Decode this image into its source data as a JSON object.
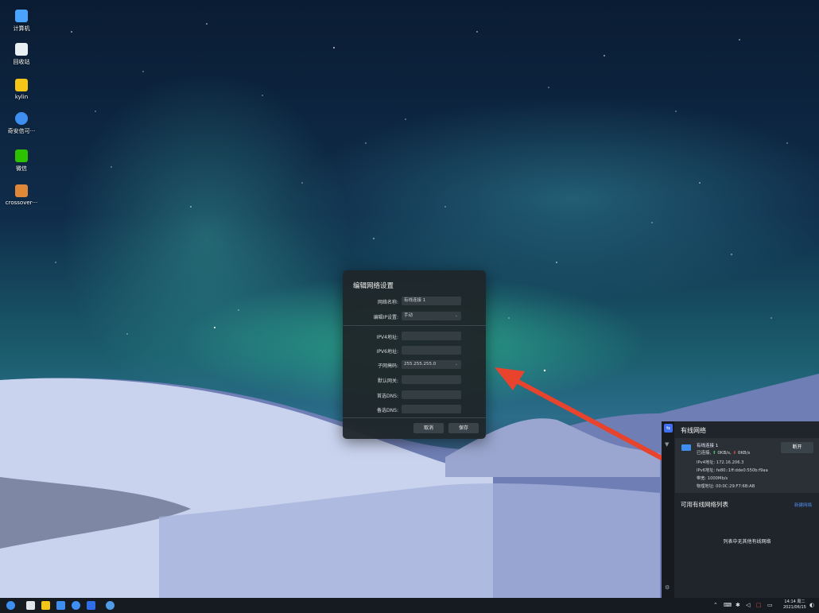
{
  "desktop": {
    "icons": [
      {
        "label": "计算机",
        "icon": "computer-icon",
        "color": "#4aa3ff"
      },
      {
        "label": "回收站",
        "icon": "trash-icon",
        "color": "#e8f0f4"
      },
      {
        "label": "kylin",
        "icon": "folder-icon",
        "color": "#f5c518"
      },
      {
        "label": "奇安信可···",
        "icon": "browser-icon",
        "color": "#3f8ef2"
      },
      {
        "label": "微信",
        "icon": "wechat-icon",
        "color": "#2dc100"
      },
      {
        "label": "crossover···",
        "icon": "crossover-icon",
        "color": "#e0883a"
      }
    ]
  },
  "dialog": {
    "title": "编辑网络设置",
    "name_label": "网络名称:",
    "name_value": "有线连接 1",
    "ip_setting_label": "编辑IP设置:",
    "ip_setting_value": "手动",
    "ipv4_label": "IPV4地址:",
    "ipv4_value": "",
    "ipv6_label": "IPV6地址:",
    "ipv6_value": "",
    "mask_label": "子网掩码:",
    "mask_value": "255.255.255.0",
    "gateway_label": "默认网关:",
    "gateway_value": "",
    "dns1_label": "首选DNS:",
    "dns1_value": "",
    "dns2_label": "备选DNS:",
    "dns2_value": "",
    "cancel_label": "取消",
    "save_label": "保存"
  },
  "net_panel": {
    "title": "有线网络",
    "connection": {
      "name": "有线连接 1",
      "status_prefix": "已连接,",
      "up_arrow": "⬆",
      "up_speed": "0KB/s,",
      "down_arrow": "⬇",
      "down_speed": "0KB/s",
      "disconnect_label": "断开",
      "ipv4": "IPv4地址: 172.16.206.3",
      "ipv6": "IPv6地址: fe80::1ff:dde0:550b:f9aa",
      "bandwidth": "带宽: 1000Mb/s",
      "mac": "物理地址: 00:0C:29:F7:6B:AB"
    },
    "available_title": "可用有线网络列表",
    "new_network_label": "新建网络",
    "empty_message": "列表中无其他有线网络"
  },
  "taskbar": {
    "time": "14:14 周二",
    "date": "2021/06/15"
  },
  "colors": {
    "accent_blue": "#3d6ff0",
    "arrow_red": "#e8432d",
    "up_green": "#3fca6a",
    "down_red": "#e04b3a"
  }
}
